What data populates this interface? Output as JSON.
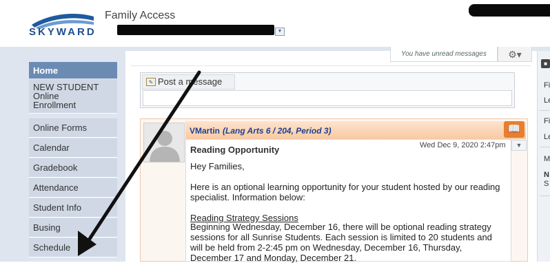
{
  "header": {
    "app_title": "Family Access",
    "logo_text": "SKYWARD"
  },
  "top_actions": {
    "unread_text": "You have unread messages",
    "settings_icon": "gear-icon"
  },
  "sidebar": {
    "items": [
      {
        "label": "Home",
        "selected": true
      },
      {
        "label": "NEW STUDENT"
      },
      {
        "label": "Online"
      },
      {
        "label": "Enrollment"
      },
      {
        "label": "Online Forms"
      },
      {
        "label": "Calendar"
      },
      {
        "label": "Gradebook"
      },
      {
        "label": "Attendance"
      },
      {
        "label": "Student Info"
      },
      {
        "label": "Busing"
      },
      {
        "label": "Schedule"
      }
    ]
  },
  "post": {
    "tab_label": "Post a message",
    "icon": "edit-note-icon"
  },
  "message": {
    "author": "VMartin",
    "class_info": "(Lang Arts 6 / 204, Period 3)",
    "subject": "Reading Opportunity",
    "date": "Wed Dec 9, 2020 2:47pm",
    "greeting": "Hey Families,",
    "para1_line1": "Here is an optional learning opportunity for your student hosted by our reading",
    "para1_line2": "specialist. Information below:",
    "session_title": "Reading Strategy Sessions",
    "para2_line1": "Beginning Wednesday, December 16, there will be optional reading strategy",
    "para2_line2": "sessions for all Sunrise Students.  Each session is limited to 20 students and",
    "para2_line3": "will be held from 2-2:45 pm on Wednesday, December 16, Thursday,",
    "para2_line4": "December 17 and Monday, December 21.",
    "book_icon": "book-icon"
  },
  "right_panel": {
    "lines": [
      "Fi",
      "Le",
      "Fi",
      "Le",
      "M",
      "N",
      "S"
    ]
  },
  "colors": {
    "nav_bg": "#dfe5ee",
    "nav_selected": "#6b8bb3",
    "message_header": "#f9c9a2",
    "author_blue": "#1f3f8f",
    "book_orange": "#e77f2e"
  }
}
